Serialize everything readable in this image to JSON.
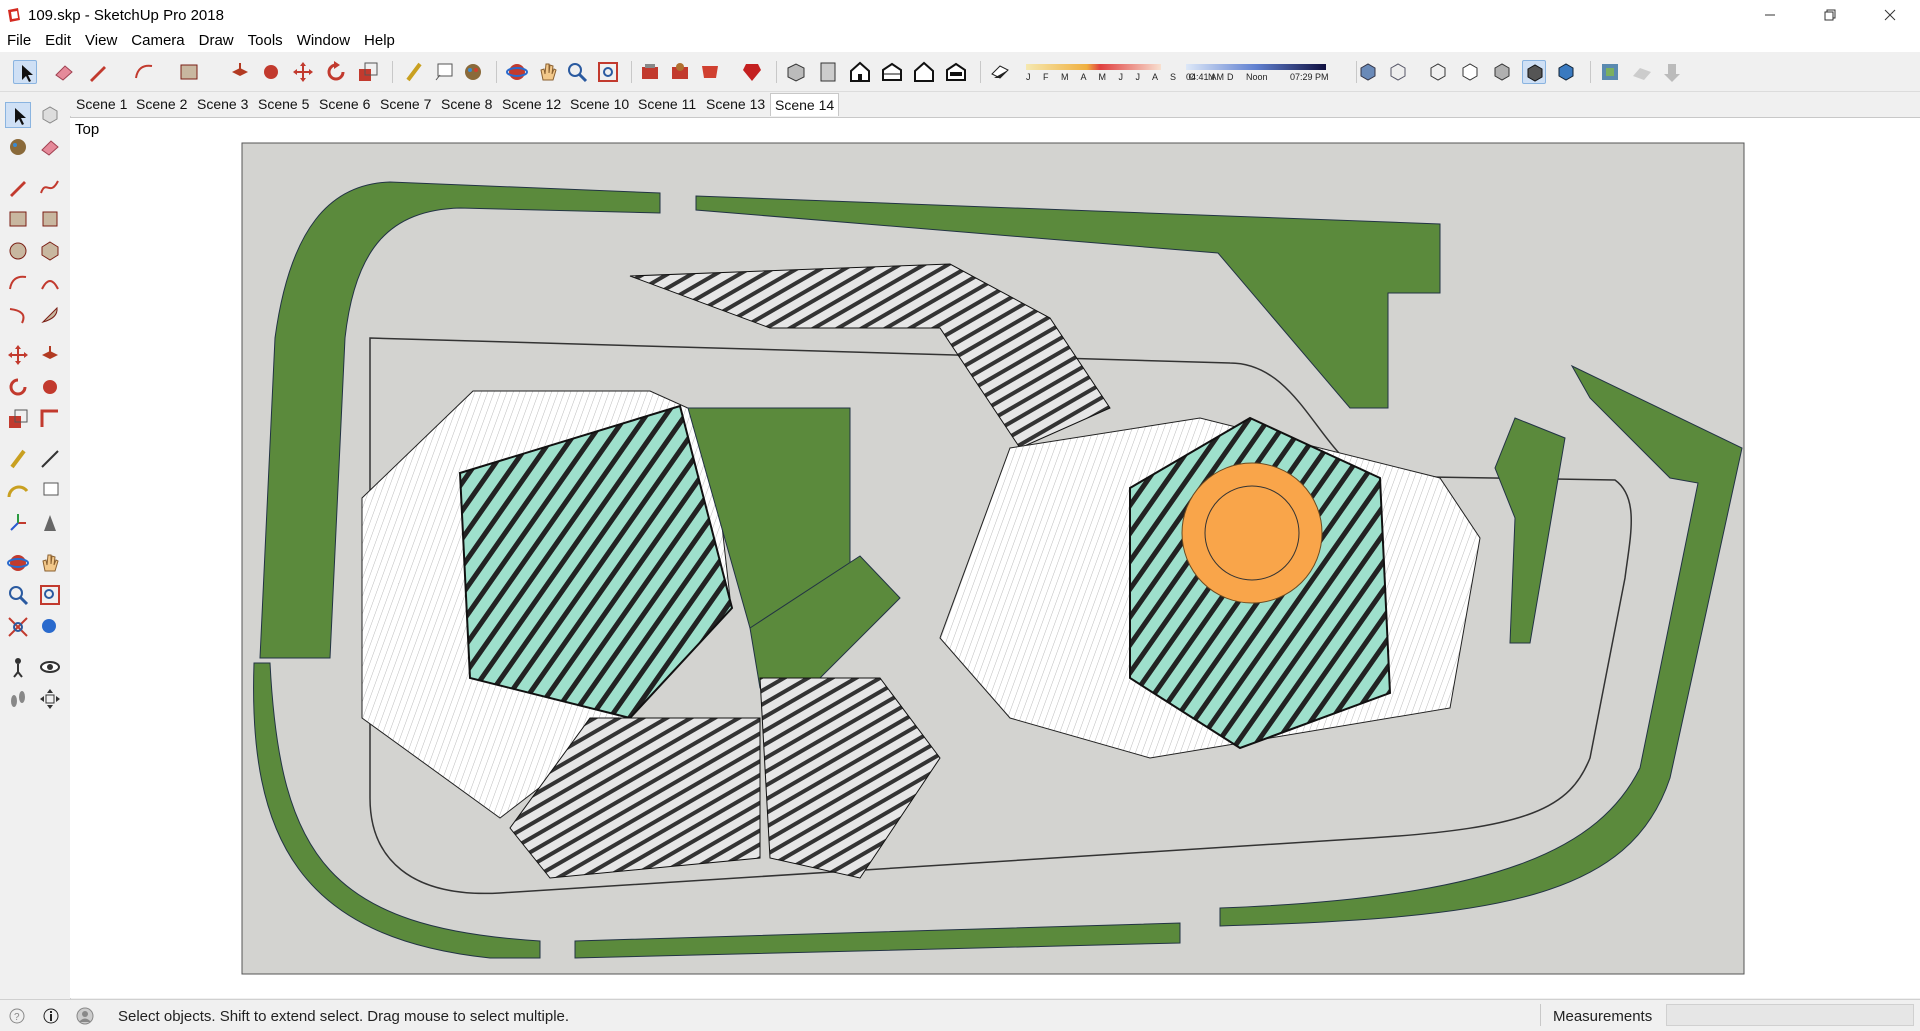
{
  "window": {
    "title": "109.skp - SketchUp Pro 2018"
  },
  "menu": [
    "File",
    "Edit",
    "View",
    "Camera",
    "Draw",
    "Tools",
    "Window",
    "Help"
  ],
  "shadow": {
    "months": "J F M A M J J A S O N D",
    "time_start": "04:41 AM",
    "time_noon": "Noon",
    "time_end": "07:29 PM"
  },
  "scenes": [
    "Scene 1",
    "Scene 2",
    "Scene 3",
    "Scene 5",
    "Scene 6",
    "Scene 7",
    "Scene 8",
    "Scene 12",
    "Scene 10",
    "Scene 11",
    "Scene 13",
    "Scene 14"
  ],
  "active_scene": "Scene 14",
  "view": {
    "label": "Top"
  },
  "status": {
    "hint": "Select objects. Shift to extend select. Drag mouse to select multiple.",
    "measurements_label": "Measurements",
    "measurements_value": ""
  },
  "colors": {
    "grass": "#5b8a3c",
    "teal": "#9ee0cc",
    "orange": "#f9a54a",
    "paving": "#cfcfcc",
    "ground": "#d3d3d0"
  }
}
